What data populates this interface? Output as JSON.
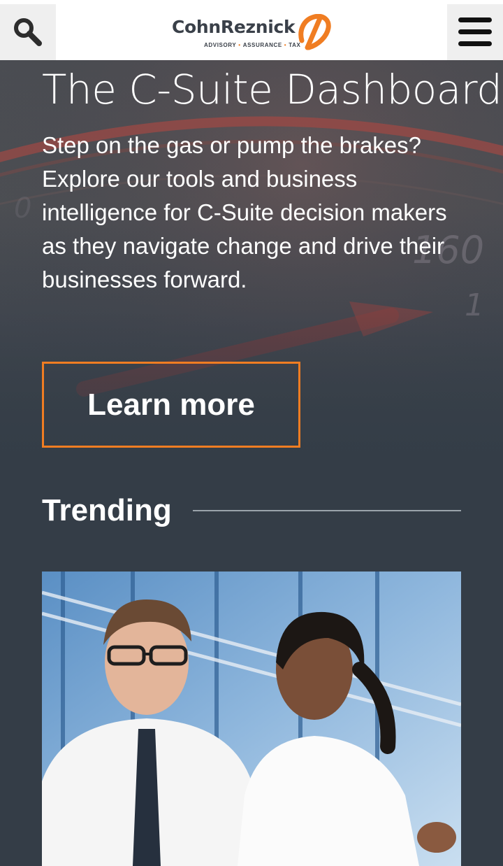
{
  "header": {
    "brand_name": "CohnReznick",
    "brand_tagline": [
      "ADVISORY",
      "ASSURANCE",
      "TAX"
    ],
    "search_icon": "search-icon",
    "menu_icon": "hamburger-menu-icon"
  },
  "hero": {
    "title": "The C-Suite Dashboard",
    "description": "Step on the gas or pump the brakes? Explore our tools and business intelligence for C-Suite decision makers as they navigate change and drive their businesses forward.",
    "cta_label": "Learn more"
  },
  "trending": {
    "title": "Trending"
  },
  "colors": {
    "accent": "#f07d22",
    "background": "#343d47",
    "header_bg": "#ffffff",
    "text_light": "#ffffff"
  }
}
